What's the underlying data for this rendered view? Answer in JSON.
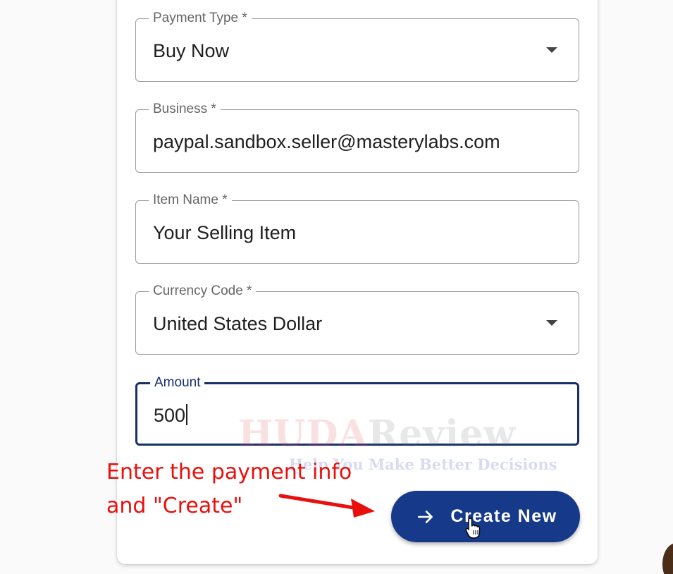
{
  "form": {
    "payment_type": {
      "label": "Payment Type *",
      "value": "Buy Now"
    },
    "business": {
      "label": "Business *",
      "value": "paypal.sandbox.seller@masterylabs.com"
    },
    "item_name": {
      "label": "Item Name *",
      "value": "Your Selling Item"
    },
    "currency_code": {
      "label": "Currency Code *",
      "value": "United States Dollar"
    },
    "amount": {
      "label": "Amount",
      "value": "500"
    },
    "create_button": {
      "label": "Create New",
      "icon": "arrow-right-icon"
    }
  },
  "overlay": {
    "watermark_main_a": "HUDA",
    "watermark_main_b": "Review",
    "watermark_sub": "Help You Make Better Decisions",
    "annotation_line1": "Enter the payment info",
    "annotation_line2": "and \"Create\""
  },
  "colors": {
    "primary": "#16398a",
    "focus_border": "#16306b",
    "annotation": "#e8100d"
  }
}
